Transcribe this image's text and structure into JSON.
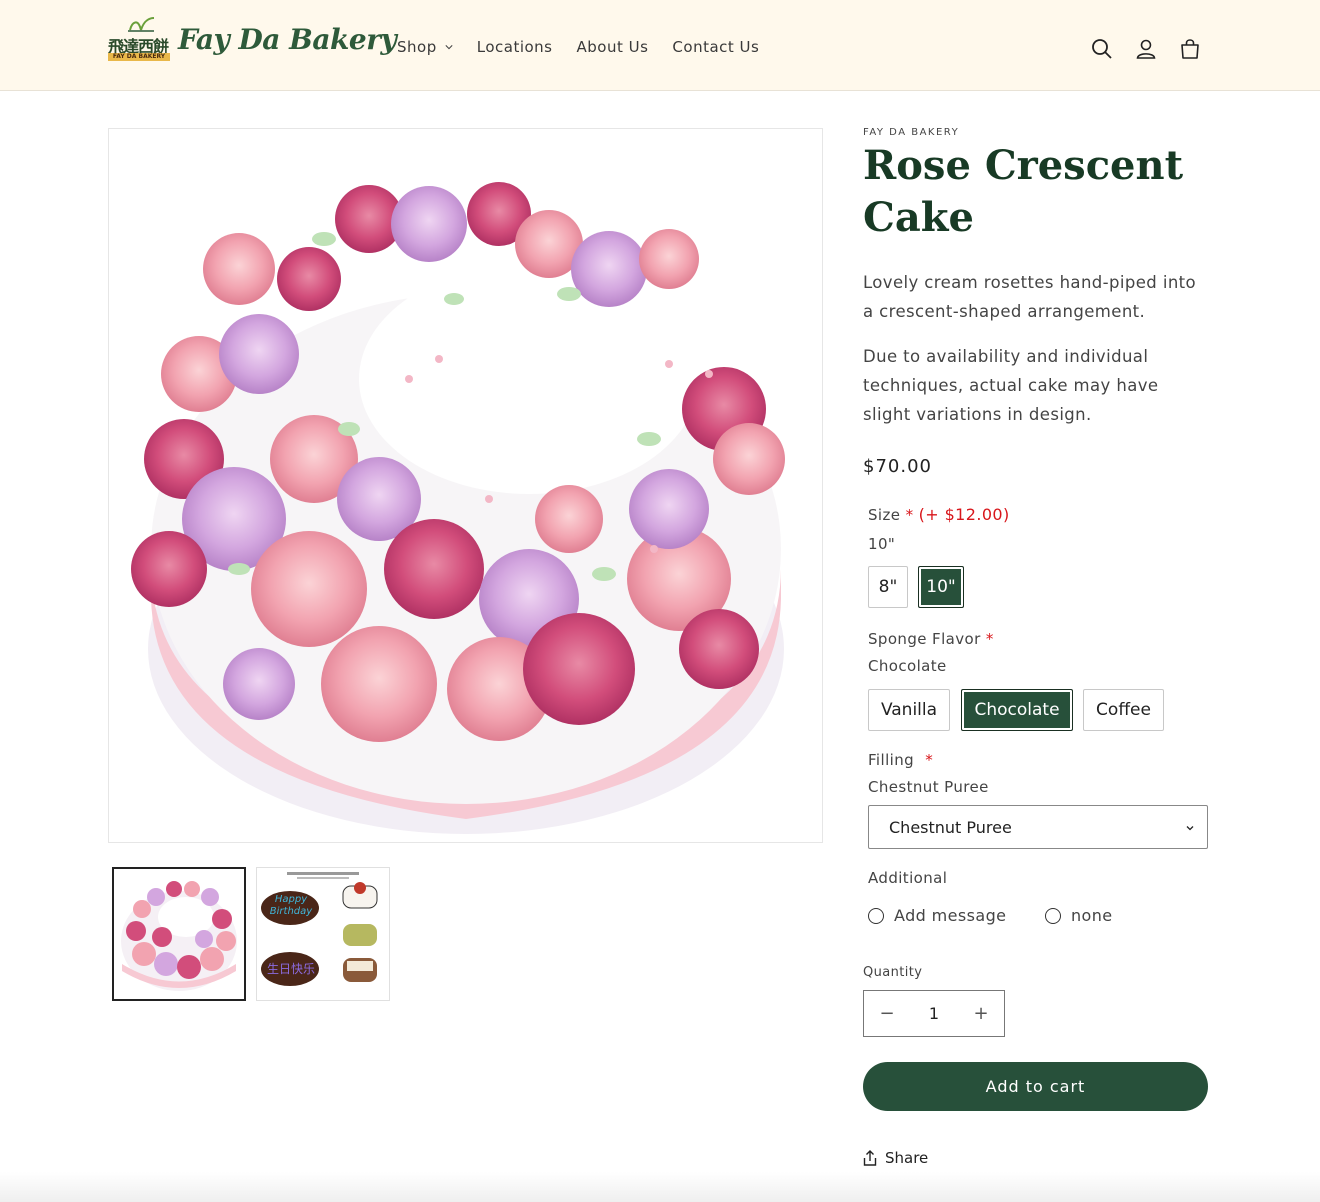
{
  "header": {
    "logo_cn": "飛達西餅",
    "logo_sub": "FAY DA BAKERY",
    "logo_script": "Fay Da Bakery",
    "nav": [
      {
        "label": "Shop",
        "has_dropdown": true
      },
      {
        "label": "Locations"
      },
      {
        "label": "About Us"
      },
      {
        "label": "Contact Us"
      }
    ],
    "icons": [
      "search-icon",
      "account-icon",
      "cart-icon"
    ]
  },
  "gallery": {
    "thumbnails": [
      {
        "name": "cake-photo",
        "active": true
      },
      {
        "name": "message-options",
        "active": false,
        "texts": [
          "Happy Birthday",
          "生日快乐"
        ]
      }
    ]
  },
  "product": {
    "vendor": "FAY DA BAKERY",
    "title": "Rose Crescent Cake",
    "description": [
      "Lovely cream rosettes hand-piped into a crescent-shaped arrangement.",
      "Due to availability and individual techniques, actual cake may have slight variations in design."
    ],
    "price": "$70.00",
    "options": {
      "size": {
        "label": "Size",
        "required_mark": "*",
        "extra_price": "(+ $12.00)",
        "selected": "10\"",
        "choices": [
          "8\"",
          "10\""
        ]
      },
      "sponge": {
        "label": "Sponge Flavor",
        "required_mark": "*",
        "selected": "Chocolate",
        "choices": [
          "Vanilla",
          "Chocolate",
          "Coffee"
        ]
      },
      "filling": {
        "label": "Filling",
        "required_mark": "*",
        "selected": "Chestnut Puree",
        "dropdown_value": "Chestnut Puree"
      },
      "additional": {
        "label": "Additional",
        "choices": [
          "Add message",
          "none"
        ]
      }
    },
    "quantity": {
      "label": "Quantity",
      "value": "1",
      "minus": "−",
      "plus": "+"
    },
    "add_to_cart": "Add to cart",
    "share": "Share"
  },
  "colors": {
    "header_bg": "#fff9ec",
    "brand_green": "#27503a",
    "title_green": "#183a25",
    "required_red": "#d8161b"
  }
}
